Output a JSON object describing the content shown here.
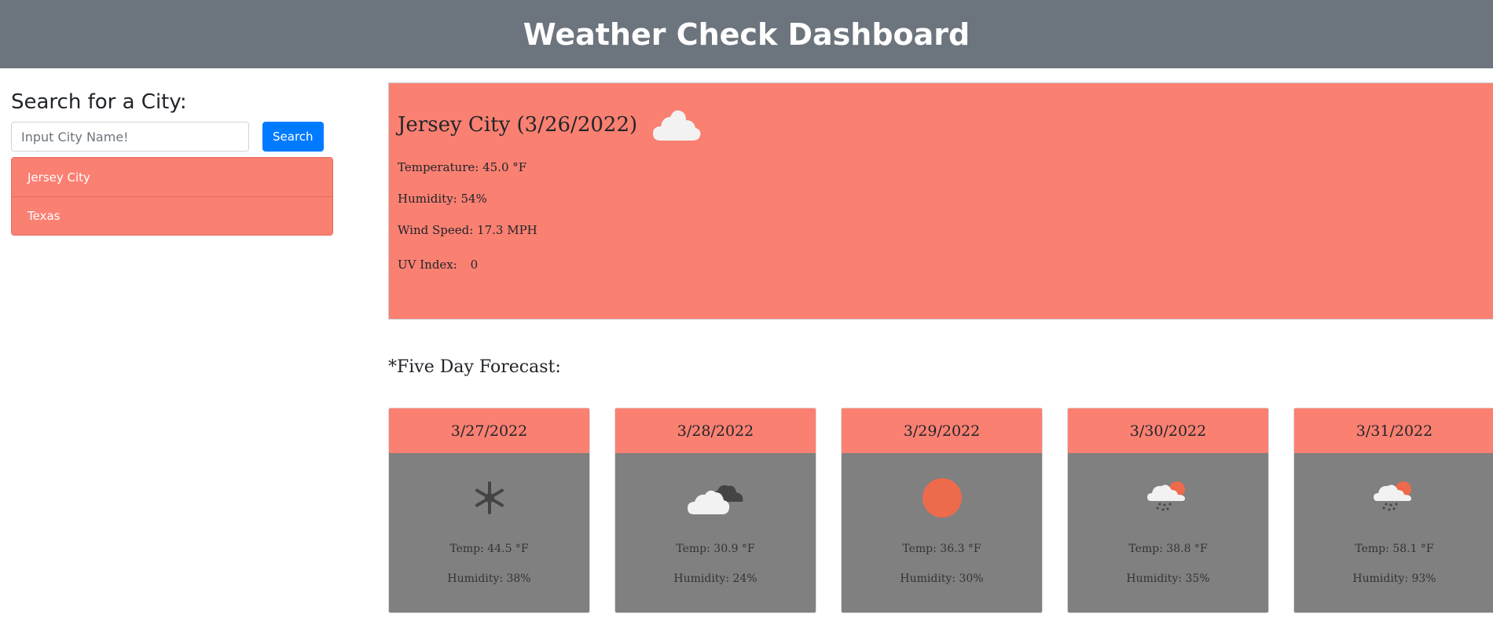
{
  "header": {
    "title": "Weather Check Dashboard"
  },
  "sidebar": {
    "heading": "Search for a City:",
    "search_placeholder": "Input City Name!",
    "search_value": "",
    "search_button": "Search",
    "history": [
      "Jersey City",
      "Texas"
    ]
  },
  "current": {
    "title": "Jersey City (3/26/2022)",
    "icon": "cloud-icon",
    "temperature": "Temperature: 45.0 °F",
    "humidity": "Humidity: 54%",
    "wind": "Wind Speed: 17.3 MPH",
    "uv_label": "UV Index:",
    "uv_value": "0"
  },
  "forecast": {
    "title": "*Five Day Forecast:",
    "days": [
      {
        "date": "3/27/2022",
        "icon": "snowflake-icon",
        "temp": "Temp: 44.5 °F",
        "humidity": "Humidity: 38%"
      },
      {
        "date": "3/28/2022",
        "icon": "clouds-icon",
        "temp": "Temp: 30.9 °F",
        "humidity": "Humidity: 24%"
      },
      {
        "date": "3/29/2022",
        "icon": "sun-icon",
        "temp": "Temp: 36.3 °F",
        "humidity": "Humidity: 30%"
      },
      {
        "date": "3/30/2022",
        "icon": "rain-sun-icon",
        "temp": "Temp: 38.8 °F",
        "humidity": "Humidity: 35%"
      },
      {
        "date": "3/31/2022",
        "icon": "rain-sun-icon",
        "temp": "Temp: 58.1 °F",
        "humidity": "Humidity: 93%"
      }
    ]
  },
  "colors": {
    "header": "#6c757d",
    "accent": "#fa8072",
    "card_body": "#808080",
    "button": "#007bff"
  }
}
